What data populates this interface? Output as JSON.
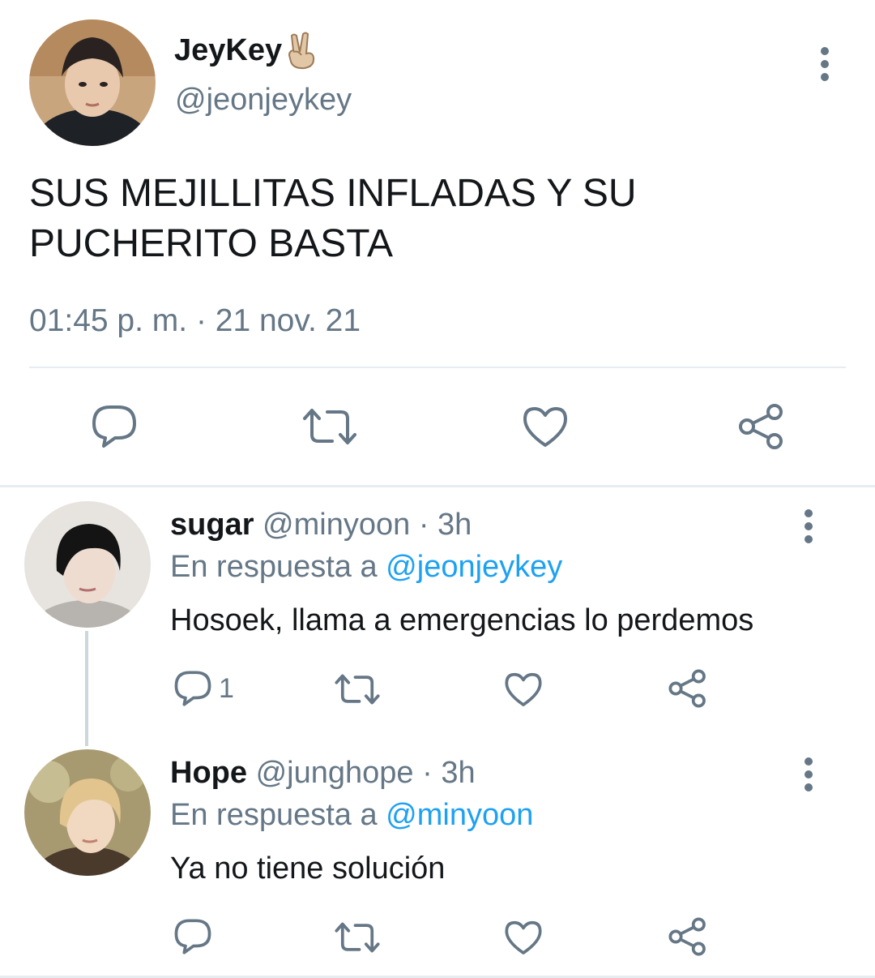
{
  "tweet": {
    "display_name": "JeyKey",
    "name_emoji": "victory-hand-emoji",
    "handle": "@jeonjeykey",
    "text": "SUS MEJILLITAS INFLADAS Y SU PUCHERITO BASTA",
    "timestamp": "01:45 p. m. · 21 nov. 21",
    "actions": [
      "reply-icon",
      "retweet-icon",
      "like-icon",
      "share-icon"
    ]
  },
  "replies": [
    {
      "display_name": "sugar",
      "handle": "@minyoon",
      "separator": "·",
      "age": "3h",
      "reply_prefix": "En respuesta a",
      "reply_to": "@jeonjeykey",
      "text": "Hosoek, llama a emergencias lo perdemos",
      "reply_count": "1"
    },
    {
      "display_name": "Hope",
      "handle": "@junghope",
      "separator": "·",
      "age": "3h",
      "reply_prefix": "En respuesta a",
      "reply_to": "@minyoon",
      "text": "Ya no tiene solución",
      "reply_count": ""
    }
  ],
  "colors": {
    "text": "#14171a",
    "secondary": "#657786",
    "link": "#1da1f2",
    "divider": "#e6ecf0"
  }
}
